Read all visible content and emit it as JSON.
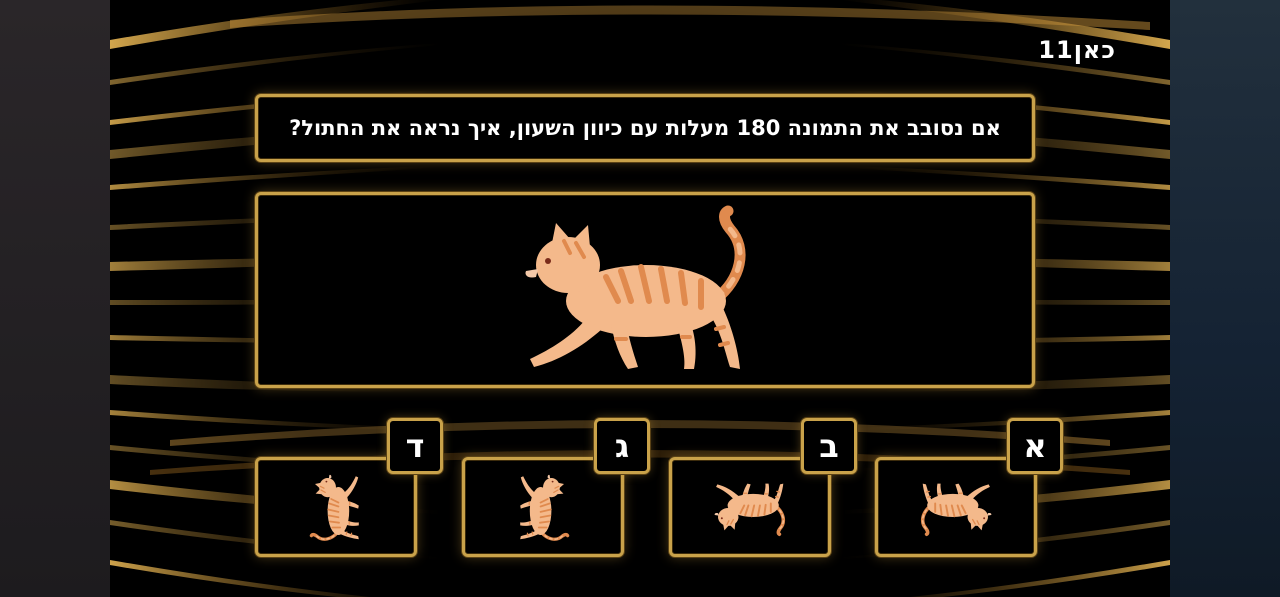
{
  "channel_logo": "כאן11",
  "question": "אם נסובב את התמונה 180 מעלות עם כיוון השעון, איך נראה את החתול?",
  "answers": [
    {
      "letter": "א",
      "orientation": "upside-down, tail left"
    },
    {
      "letter": "ב",
      "orientation": "upside-down, tail right"
    },
    {
      "letter": "ג",
      "orientation": "vertical, head up"
    },
    {
      "letter": "ד",
      "orientation": "vertical, head up, mirrored"
    }
  ],
  "colors": {
    "gold_border": "#c9a24a",
    "cat_fur": "#f4b98b",
    "cat_stripe": "#e08a4e"
  }
}
